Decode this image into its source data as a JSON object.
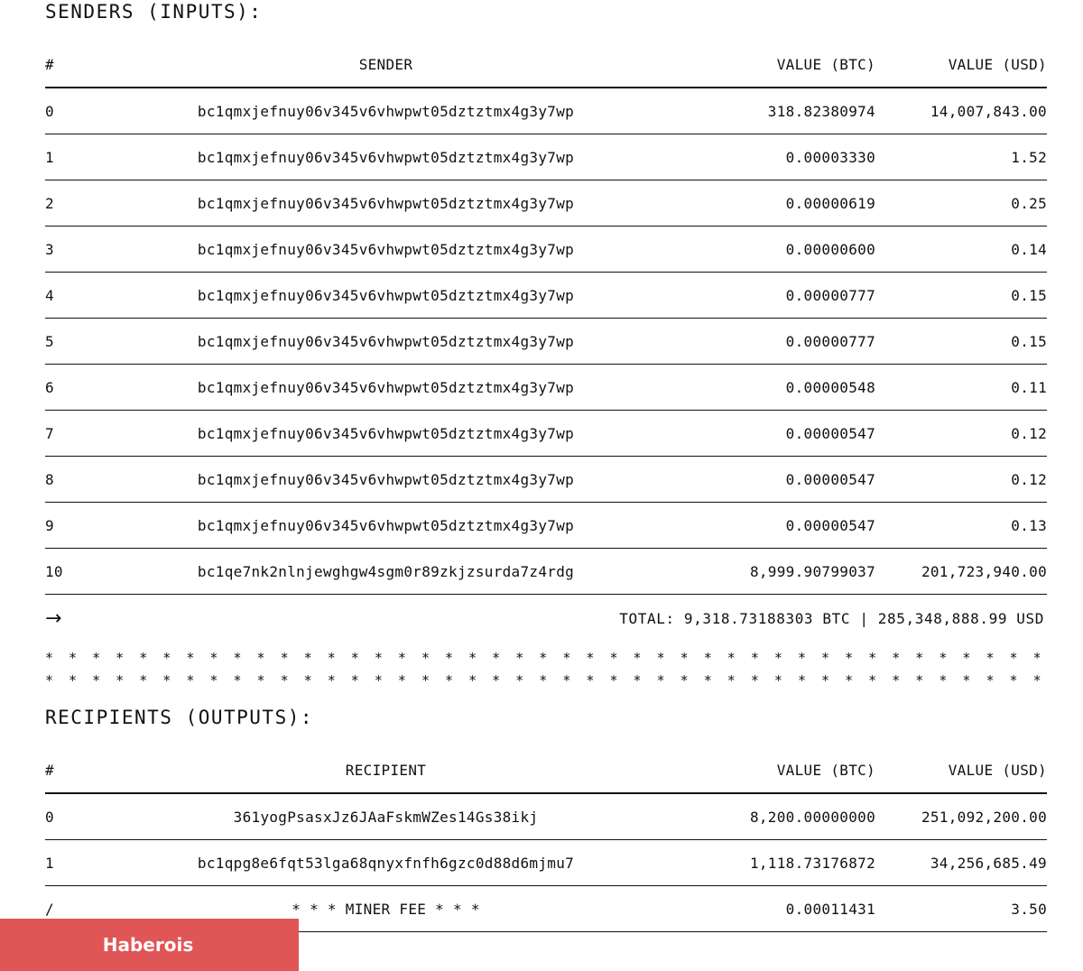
{
  "senders": {
    "title": "SENDERS (INPUTS):",
    "columns": {
      "index": "#",
      "address": "SENDER",
      "btc": "VALUE (BTC)",
      "usd": "VALUE (USD)"
    },
    "rows": [
      {
        "index": "0",
        "address": "bc1qmxjefnuy06v345v6vhwpwt05dztztmx4g3y7wp",
        "btc": "318.82380974",
        "usd": "14,007,843.00"
      },
      {
        "index": "1",
        "address": "bc1qmxjefnuy06v345v6vhwpwt05dztztmx4g3y7wp",
        "btc": "0.00003330",
        "usd": "1.52"
      },
      {
        "index": "2",
        "address": "bc1qmxjefnuy06v345v6vhwpwt05dztztmx4g3y7wp",
        "btc": "0.00000619",
        "usd": "0.25"
      },
      {
        "index": "3",
        "address": "bc1qmxjefnuy06v345v6vhwpwt05dztztmx4g3y7wp",
        "btc": "0.00000600",
        "usd": "0.14"
      },
      {
        "index": "4",
        "address": "bc1qmxjefnuy06v345v6vhwpwt05dztztmx4g3y7wp",
        "btc": "0.00000777",
        "usd": "0.15"
      },
      {
        "index": "5",
        "address": "bc1qmxjefnuy06v345v6vhwpwt05dztztmx4g3y7wp",
        "btc": "0.00000777",
        "usd": "0.15"
      },
      {
        "index": "6",
        "address": "bc1qmxjefnuy06v345v6vhwpwt05dztztmx4g3y7wp",
        "btc": "0.00000548",
        "usd": "0.11"
      },
      {
        "index": "7",
        "address": "bc1qmxjefnuy06v345v6vhwpwt05dztztmx4g3y7wp",
        "btc": "0.00000547",
        "usd": "0.12"
      },
      {
        "index": "8",
        "address": "bc1qmxjefnuy06v345v6vhwpwt05dztztmx4g3y7wp",
        "btc": "0.00000547",
        "usd": "0.12"
      },
      {
        "index": "9",
        "address": "bc1qmxjefnuy06v345v6vhwpwt05dztztmx4g3y7wp",
        "btc": "0.00000547",
        "usd": "0.13"
      },
      {
        "index": "10",
        "address": "bc1qe7nk2nlnjewghgw4sgm0r89zkjzsurda7z4rdg",
        "btc": "8,999.90799037",
        "usd": "201,723,940.00"
      }
    ],
    "arrow_icon": "arrow-right-icon",
    "arrow_glyph": "→",
    "total": "TOTAL: 9,318.73188303 BTC | 285,348,888.99 USD"
  },
  "separator": {
    "line1": "* * * * * * * * * * * * * * * * * * * * * * * * * * * * * * * * * * * * * * * * * * * * * * * * * * * * * * * *",
    "line2": "* * * * * * * * * * * * * * * * * * * * * * * * * * * * * * * * * * * * * * * * * * * * * * * * * * * * * * * *"
  },
  "recipients": {
    "title": "RECIPIENTS (OUTPUTS):",
    "columns": {
      "index": "#",
      "address": "RECIPIENT",
      "btc": "VALUE (BTC)",
      "usd": "VALUE (USD)"
    },
    "rows": [
      {
        "index": "0",
        "address": "361yogPsasxJz6JAaFskmWZes14Gs38ikj",
        "btc": "8,200.00000000",
        "usd": "251,092,200.00"
      },
      {
        "index": "1",
        "address": "bc1qpg8e6fqt53lga68qnyxfnfh6gzc0d88d6mjmu7",
        "btc": "1,118.73176872",
        "usd": "34,256,685.49"
      },
      {
        "index": "/",
        "address": "* * * MINER FEE * * *",
        "btc": "0.00011431",
        "usd": "3.50"
      }
    ]
  },
  "badge": {
    "label": "Haberois",
    "color": "#e05555"
  }
}
